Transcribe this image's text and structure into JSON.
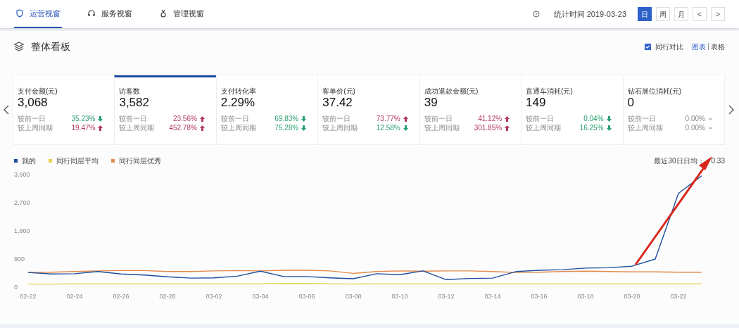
{
  "nav_tabs": [
    {
      "label": "运营视窗",
      "selected": true
    },
    {
      "label": "服务视窗",
      "selected": false
    },
    {
      "label": "管理视窗",
      "selected": false
    }
  ],
  "stat_time": "统计时间 2019-03-23",
  "period_buttons": [
    {
      "label": "日",
      "selected": true
    },
    {
      "label": "周",
      "selected": false
    },
    {
      "label": "月",
      "selected": false
    }
  ],
  "pager": {
    "prev": "<",
    "next": ">"
  },
  "panel": {
    "title": "整体看板",
    "compare": {
      "label": "同行对比",
      "checked": true
    },
    "views": [
      {
        "label": "图表",
        "selected": true
      },
      {
        "label": "表格",
        "selected": false
      }
    ]
  },
  "metrics": [
    {
      "title": "支付金额(元)",
      "value": "3,068",
      "selected": false,
      "rows": [
        {
          "label": "较前一日",
          "pct": "35.23%",
          "kind": "down"
        },
        {
          "label": "较上周同期",
          "pct": "19.47%",
          "kind": "up"
        }
      ]
    },
    {
      "title": "访客数",
      "value": "3,582",
      "selected": true,
      "rows": [
        {
          "label": "较前一日",
          "pct": "23.56%",
          "kind": "up"
        },
        {
          "label": "较上周同期",
          "pct": "452.78%",
          "kind": "up"
        }
      ]
    },
    {
      "title": "支付转化率",
      "value": "2.29%",
      "selected": false,
      "rows": [
        {
          "label": "较前一日",
          "pct": "69.83%",
          "kind": "down"
        },
        {
          "label": "较上周同期",
          "pct": "75.28%",
          "kind": "down"
        }
      ]
    },
    {
      "title": "客单价(元)",
      "value": "37.42",
      "selected": false,
      "rows": [
        {
          "label": "较前一日",
          "pct": "73.77%",
          "kind": "up"
        },
        {
          "label": "较上周同期",
          "pct": "12.58%",
          "kind": "down"
        }
      ]
    },
    {
      "title": "成功退款金额(元)",
      "value": "39",
      "selected": false,
      "rows": [
        {
          "label": "较前一日",
          "pct": "41.12%",
          "kind": "up"
        },
        {
          "label": "较上周同期",
          "pct": "301.85%",
          "kind": "up"
        }
      ]
    },
    {
      "title": "直通车消耗(元)",
      "value": "149",
      "selected": false,
      "rows": [
        {
          "label": "较前一日",
          "pct": "0.04%",
          "kind": "down"
        },
        {
          "label": "较上周同期",
          "pct": "16.25%",
          "kind": "down"
        }
      ]
    },
    {
      "title": "钻石展位消耗(元)",
      "value": "0",
      "selected": false,
      "rows": [
        {
          "label": "较前一日",
          "pct": "0.00%",
          "kind": "flat"
        },
        {
          "label": "较上周同期",
          "pct": "0.00%",
          "kind": "flat"
        }
      ]
    }
  ],
  "average": {
    "label": "最近30日日均：",
    "value": "0.33"
  },
  "chart_data": {
    "type": "line",
    "categories": [
      "02-22",
      null,
      "02-24",
      null,
      "02-26",
      null,
      "02-28",
      null,
      "03-02",
      null,
      "03-04",
      null,
      "03-06",
      null,
      "03-08",
      null,
      "03-10",
      null,
      "03-12",
      null,
      "03-14",
      null,
      "03-16",
      null,
      "03-18",
      null,
      "03-20",
      null,
      "03-22",
      null
    ],
    "yticks": [
      {
        "value": 0,
        "label": "0"
      },
      {
        "value": 900,
        "label": "900"
      },
      {
        "value": 1800,
        "label": "1,800"
      },
      {
        "value": 2700,
        "label": "2,700"
      },
      {
        "value": 3600,
        "label": "3,600"
      }
    ],
    "ylim": [
      0,
      3600
    ],
    "series": [
      {
        "name": "我的",
        "color": "#1d4d9c",
        "values": [
          470,
          420,
          430,
          500,
          420,
          390,
          330,
          290,
          300,
          350,
          510,
          340,
          340,
          300,
          270,
          430,
          400,
          520,
          240,
          280,
          290,
          500,
          540,
          560,
          610,
          620,
          670,
          900,
          3000,
          3560
        ]
      },
      {
        "name": "同行同层平均",
        "color": "#e6d14a",
        "values": [
          100,
          100,
          110,
          110,
          110,
          110,
          110,
          110,
          110,
          110,
          110,
          120,
          120,
          110,
          100,
          110,
          110,
          110,
          110,
          110,
          110,
          110,
          110,
          110,
          110,
          110,
          110,
          110,
          110,
          110
        ]
      },
      {
        "name": "同行同层优秀",
        "color": "#e2894a",
        "values": [
          470,
          480,
          500,
          520,
          530,
          530,
          500,
          500,
          520,
          530,
          520,
          540,
          540,
          520,
          440,
          500,
          520,
          510,
          520,
          520,
          500,
          470,
          480,
          500,
          510,
          500,
          490,
          490,
          480,
          480
        ]
      }
    ]
  },
  "annotation": {
    "kind": "arrow",
    "color": "#d9261c"
  }
}
